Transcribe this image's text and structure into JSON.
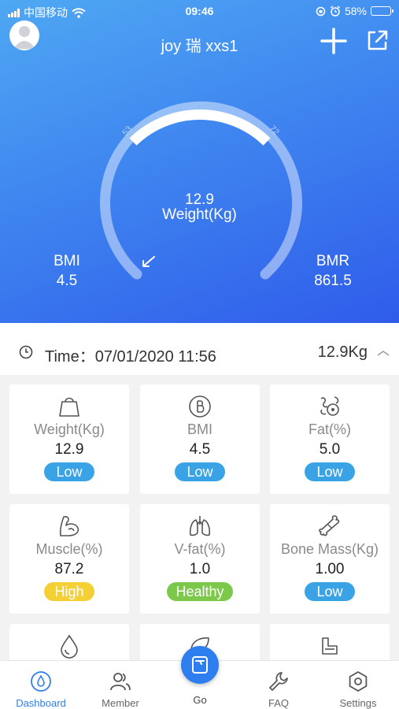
{
  "status_bar": {
    "carrier": "中国移动",
    "time": "09:46",
    "battery": "58%"
  },
  "header": {
    "title": "joy 瑞 xxs1"
  },
  "gauge": {
    "value": "12.9",
    "unit_label": "Weight(Kg)",
    "range_low": "53",
    "range_high": "72",
    "left_label": "BMI",
    "left_value": "4.5",
    "right_label": "BMR",
    "right_value": "861.5"
  },
  "record": {
    "time_label": "Time：07/01/2020 11:56",
    "weight": "12.9Kg"
  },
  "cards": [
    {
      "label": "Weight(Kg)",
      "value": "12.9",
      "status": "Low",
      "status_color": "#3aa3e6",
      "icon": "scale-icon"
    },
    {
      "label": "BMI",
      "value": "4.5",
      "status": "Low",
      "status_color": "#3aa3e6",
      "icon": "bmi-icon"
    },
    {
      "label": "Fat(%)",
      "value": "5.0",
      "status": "Low",
      "status_color": "#3aa3e6",
      "icon": "fat-icon"
    },
    {
      "label": "Muscle(%)",
      "value": "87.2",
      "status": "High",
      "status_color": "#f5d035",
      "icon": "muscle-icon"
    },
    {
      "label": "V-fat(%)",
      "value": "1.0",
      "status": "Healthy",
      "status_color": "#7cc84a",
      "icon": "lungs-icon"
    },
    {
      "label": "Bone Mass(Kg)",
      "value": "1.00",
      "status": "Low",
      "status_color": "#3aa3e6",
      "icon": "bone-icon"
    }
  ],
  "nav": {
    "dashboard": "Dashboard",
    "member": "Member",
    "go": "Go",
    "faq": "FAQ",
    "settings": "Settings",
    "active_color": "#2f7ef0"
  }
}
